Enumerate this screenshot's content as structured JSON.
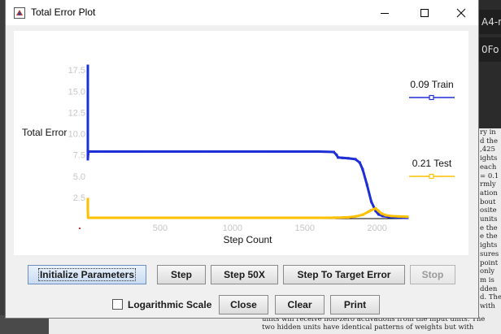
{
  "window": {
    "title": "Total Error Plot",
    "controls": {
      "minimize_icon": "minimize-icon",
      "maximize_icon": "maximize-icon",
      "close_icon": "close-icon"
    }
  },
  "background": {
    "tabs": [
      "A4-n",
      "0Fo"
    ],
    "doc_lines": [
      "ry in",
      "d the",
      ",425",
      "ights",
      "each",
      "= 0.1",
      "rmly",
      "ation",
      "bout",
      "osite",
      "units",
      "e the",
      "e the",
      "ights",
      "sures",
      "point",
      "only",
      "m is",
      "dden",
      "d. The",
      "with"
    ],
    "doc_bottom_lines": [
      "units will receive non-zero activations from the input units. The",
      "two hidden units have identical patterns of weights but with"
    ]
  },
  "chart_data": {
    "type": "line",
    "title": "",
    "xlabel": "Step Count",
    "ylabel": "Total Error",
    "xlim": [
      0,
      2210
    ],
    "ylim": [
      0,
      18
    ],
    "xticks": [
      500,
      1000,
      1500,
      2000
    ],
    "yticks": [
      2.5,
      5.0,
      7.5,
      10.0,
      12.5,
      15.0,
      17.5
    ],
    "ytick_labels": [
      "2.5",
      "5.0",
      "7.5",
      "10.0",
      "12.5",
      "15.0",
      "17.5"
    ],
    "grid": false,
    "legend_position": "right",
    "series": [
      {
        "name": "Train",
        "legend_label": "0.09 Train",
        "color": "#1f2fd6",
        "x": [
          0,
          0,
          2,
          4,
          6,
          10,
          20,
          100,
          400,
          800,
          1200,
          1600,
          1700,
          1720,
          1730,
          1760,
          1800,
          1850,
          1880,
          1900,
          1930,
          1960,
          1990,
          2010,
          2040,
          2080,
          2130,
          2180,
          2210
        ],
        "y": [
          18.0,
          7.0,
          7.6,
          7.9,
          7.9,
          7.9,
          7.9,
          7.9,
          7.9,
          7.9,
          7.9,
          7.9,
          7.85,
          7.5,
          7.2,
          7.15,
          7.1,
          7.0,
          6.6,
          5.8,
          4.0,
          2.0,
          0.9,
          0.5,
          0.3,
          0.2,
          0.14,
          0.11,
          0.09
        ]
      },
      {
        "name": "Test",
        "legend_label": "0.21 Test",
        "color": "#ffc000",
        "x": [
          0,
          0,
          2,
          10,
          100,
          400,
          800,
          1200,
          1600,
          1700,
          1800,
          1850,
          1900,
          1940,
          1960,
          1990,
          2010,
          2030,
          2060,
          2100,
          2150,
          2210
        ],
        "y": [
          2.3,
          1.0,
          0.12,
          0.1,
          0.1,
          0.1,
          0.1,
          0.1,
          0.1,
          0.11,
          0.15,
          0.25,
          0.45,
          0.8,
          1.0,
          1.2,
          0.9,
          0.6,
          0.4,
          0.3,
          0.25,
          0.21
        ]
      }
    ]
  },
  "buttons": {
    "initialize": "Initialize Parameters",
    "step": "Step",
    "step50": "Step 50X",
    "step_target": "Step To Target Error",
    "stop": "Stop",
    "close": "Close",
    "clear": "Clear",
    "print": "Print"
  },
  "log_scale": {
    "label": "Logarithmic Scale",
    "checked": false
  }
}
